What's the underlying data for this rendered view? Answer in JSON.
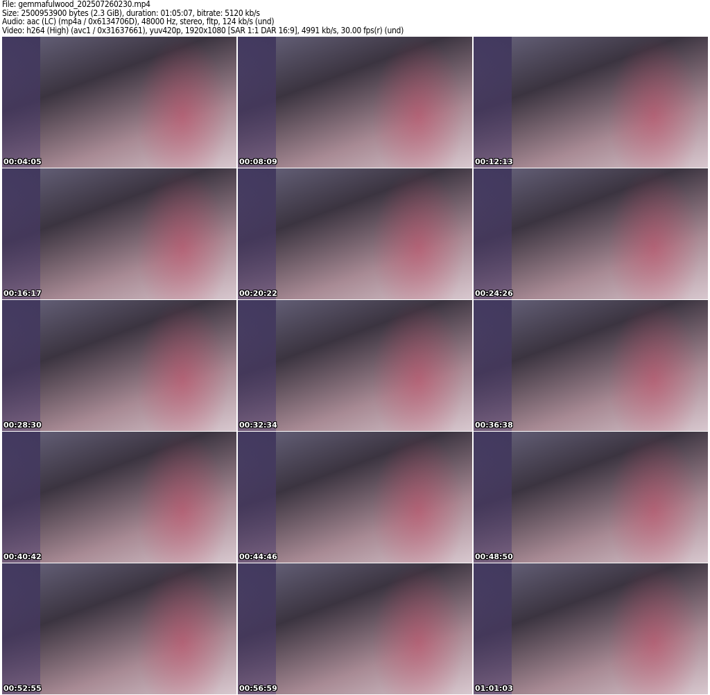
{
  "header": {
    "file": "File: gemmafulwood_202507260230.mp4",
    "size": "Size: 2500953900 bytes (2.3 GiB), duration: 01:05:07, bitrate: 5120 kb/s",
    "audio": "Audio: aac (LC) (mp4a / 0x6134706D), 48000 Hz, stereo, fltp, 124 kb/s (und)",
    "video": "Video: h264 (High) (avc1 / 0x31637661), yuv420p, 1920x1080 [SAR 1:1 DAR 16:9], 4991 kb/s, 30.00 fps(r) (und)"
  },
  "thumbnails": [
    "00:04:05",
    "00:08:09",
    "00:12:13",
    "00:16:17",
    "00:20:22",
    "00:24:26",
    "00:28:30",
    "00:32:34",
    "00:36:38",
    "00:40:42",
    "00:44:46",
    "00:48:50",
    "00:52:55",
    "00:56:59",
    "01:01:03"
  ]
}
